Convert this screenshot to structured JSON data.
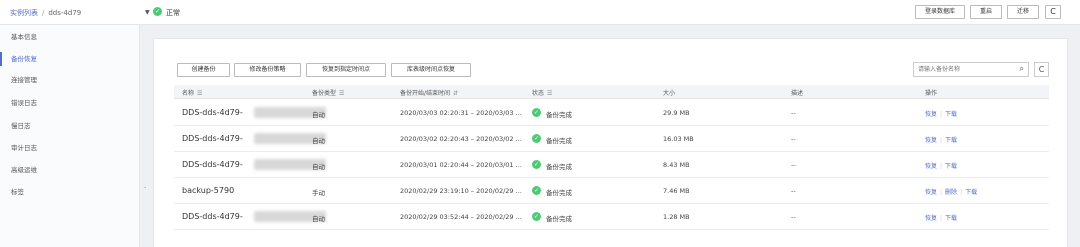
{
  "header": {
    "breadcrumb_root": "实例列表",
    "breadcrumb_sep": "/",
    "instance_name": "dds-4d79",
    "dropdown_caret": "▼",
    "status_icon": "✓",
    "status_text": "正常",
    "buttons": {
      "login": "登录数据库",
      "restart": "重启",
      "migrate": "迁移",
      "refresh": "C"
    }
  },
  "sidebar": {
    "items": [
      {
        "label": "基本信息"
      },
      {
        "label": "备份恢复",
        "active": true
      },
      {
        "label": "连接管理"
      },
      {
        "label": "错误日志"
      },
      {
        "label": "慢日志"
      },
      {
        "label": "审计日志"
      },
      {
        "label": "高级运维"
      },
      {
        "label": "标签"
      }
    ],
    "collapse_marker": "·"
  },
  "toolbar": {
    "create_backup": "创建备份",
    "modify_policy": "修改备份策略",
    "restore_point": "恢复到指定时间点",
    "db_restore": "库表级时间点恢复",
    "search_placeholder": "请输入备份名称",
    "search_icon": "⌕",
    "refresh_icon": "C"
  },
  "table": {
    "headers": {
      "name": "名称",
      "type": "备份类型",
      "time": "备份开始/结束时间",
      "status": "状态",
      "size": "大小",
      "desc": "描述",
      "ops": "操作"
    },
    "header_icons": {
      "filter": "☰",
      "sort": "⇵"
    },
    "rows": [
      {
        "name": "DDS-dds-4d79-",
        "blurred": true,
        "type": "自动",
        "time": "2020/03/03 02:20:31 – 2020/03/03 ...",
        "status": "备份完成",
        "size": "29.9 MB",
        "desc": "--",
        "ops": [
          "恢复",
          "下载"
        ]
      },
      {
        "name": "DDS-dds-4d79-",
        "blurred": true,
        "type": "自动",
        "time": "2020/03/02 02:20:43 – 2020/03/02 ...",
        "status": "备份完成",
        "size": "16.03 MB",
        "desc": "--",
        "ops": [
          "恢复",
          "下载"
        ]
      },
      {
        "name": "DDS-dds-4d79-",
        "blurred": true,
        "type": "自动",
        "time": "2020/03/01 02:20:44 – 2020/03/01 ...",
        "status": "备份完成",
        "size": "8.43 MB",
        "desc": "--",
        "ops": [
          "恢复",
          "下载"
        ]
      },
      {
        "name": "backup-5790",
        "blurred": false,
        "type": "手动",
        "time": "2020/02/29 23:19:10 – 2020/02/29 ...",
        "status": "备份完成",
        "size": "7.46 MB",
        "desc": "--",
        "ops": [
          "恢复",
          "删除",
          "下载"
        ]
      },
      {
        "name": "DDS-dds-4d79-",
        "blurred": true,
        "type": "自动",
        "time": "2020/02/29 03:52:44 – 2020/02/29 ...",
        "status": "备份完成",
        "size": "1.28 MB",
        "desc": "--",
        "ops": [
          "恢复",
          "下载"
        ]
      }
    ],
    "status_icon": "✓"
  },
  "colors": {
    "accent": "#526ecc",
    "success": "#50c878"
  }
}
